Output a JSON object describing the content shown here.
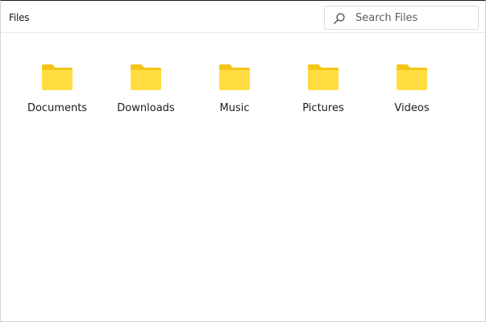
{
  "window": {
    "title": "Files"
  },
  "search": {
    "placeholder": "Search Files",
    "value": ""
  },
  "folders": [
    {
      "label": "Documents",
      "icon": "folder-icon"
    },
    {
      "label": "Downloads",
      "icon": "folder-icon"
    },
    {
      "label": "Music",
      "icon": "folder-icon"
    },
    {
      "label": "Pictures",
      "icon": "folder-icon"
    },
    {
      "label": "Videos",
      "icon": "folder-icon"
    }
  ],
  "colors": {
    "folder_front": "#FFD93B",
    "folder_back": "#F5C518",
    "border": "#DCDCDC",
    "text": "#1B1B1B"
  }
}
